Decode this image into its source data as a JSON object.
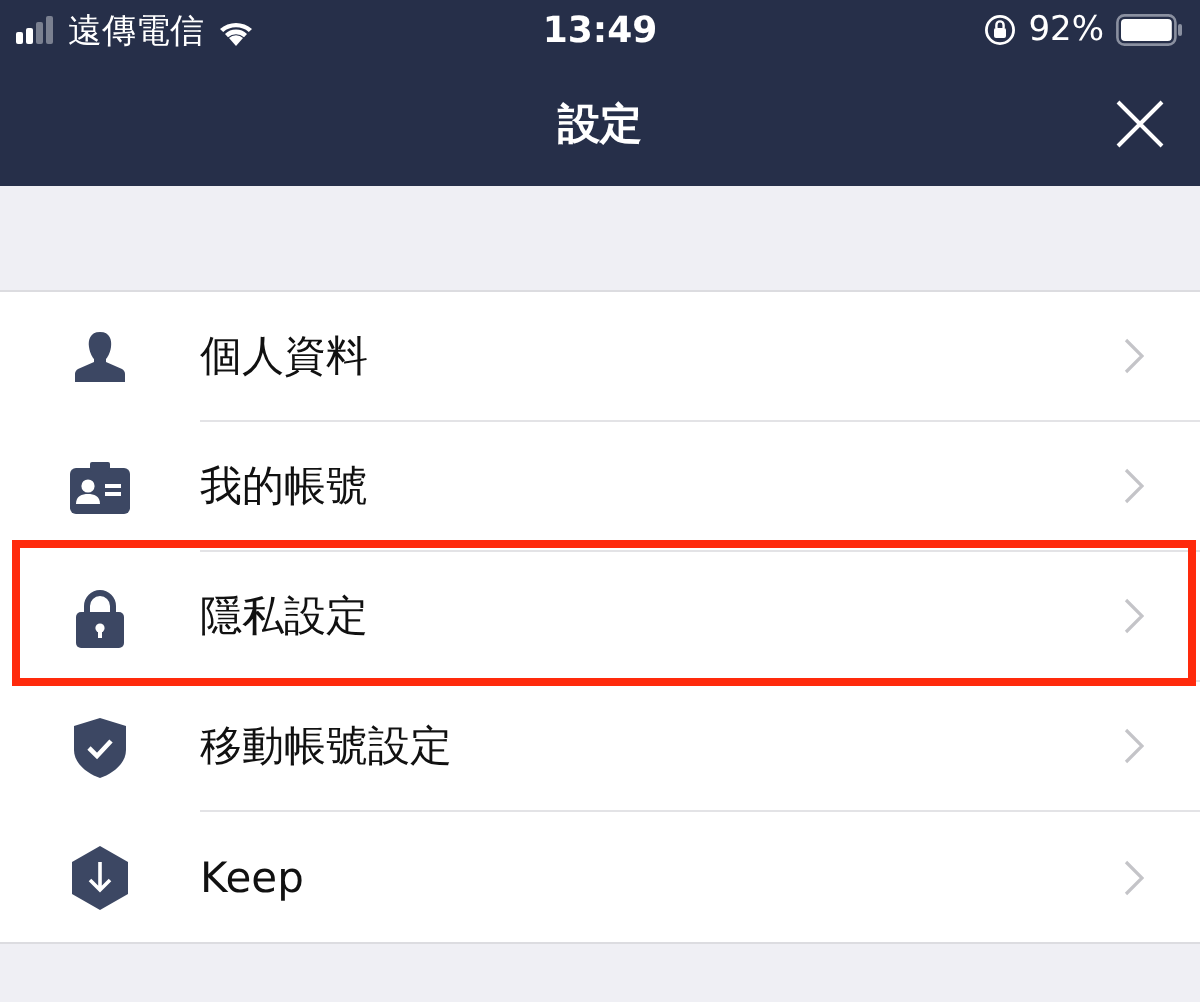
{
  "status_bar": {
    "carrier": "遠傳電信",
    "time": "13:49",
    "battery": "92%"
  },
  "header": {
    "title": "設定"
  },
  "items": [
    {
      "label": "個人資料",
      "highlighted": false
    },
    {
      "label": "我的帳號",
      "highlighted": false
    },
    {
      "label": "隱私設定",
      "highlighted": true
    },
    {
      "label": "移動帳號設定",
      "highlighted": false
    },
    {
      "label": "Keep",
      "highlighted": false
    }
  ]
}
